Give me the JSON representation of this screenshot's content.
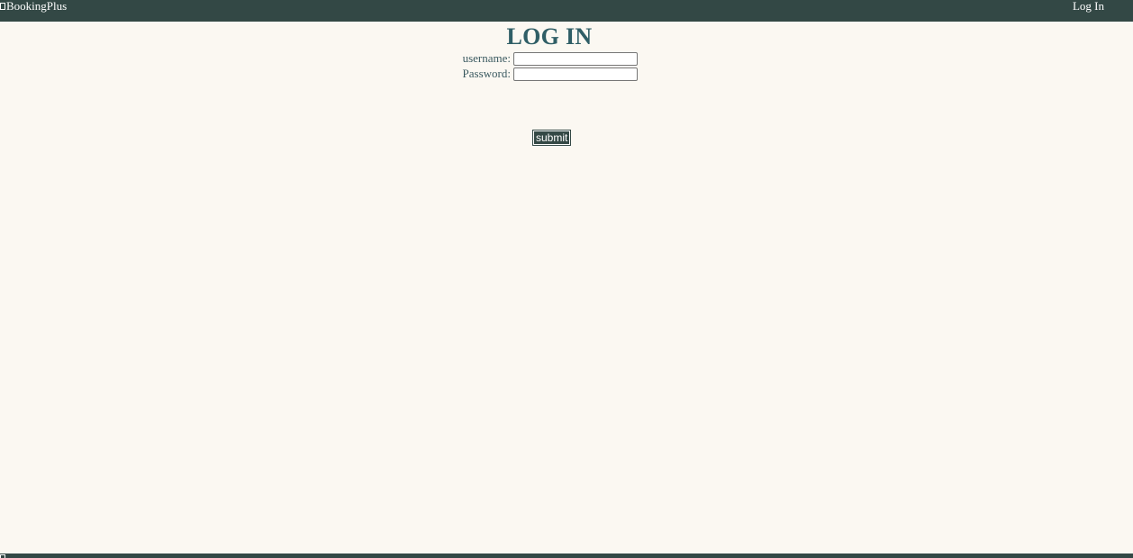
{
  "header": {
    "brand_icon": "book-icon",
    "brand": "BookingPlus",
    "login_link": "Log In"
  },
  "main": {
    "title": "LOG IN",
    "username_label": "username:",
    "username_value": "",
    "password_label": "Password:",
    "password_value": "",
    "submit_label": "submit"
  },
  "footer": {
    "brand_icon": "book-icon"
  },
  "colors": {
    "bar": "#334845",
    "background": "#FBF8F2",
    "title": "#2F5E66"
  }
}
